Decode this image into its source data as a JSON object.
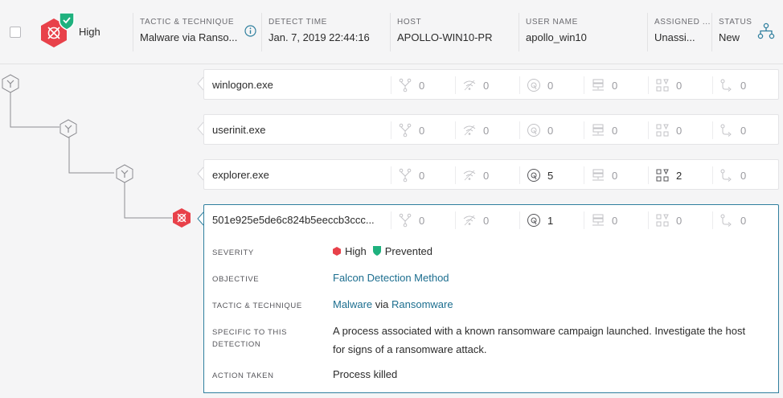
{
  "header": {
    "severity": "High",
    "tactic_label": "TACTIC & TECHNIQUE",
    "tactic_value": "Malware via Ranso...",
    "detect_label": "DETECT TIME",
    "detect_value": "Jan. 7, 2019 22:44:16",
    "host_label": "HOST",
    "host_value": "APOLLO-WIN10-PR",
    "user_label": "USER NAME",
    "user_value": "apollo_win10",
    "assigned_label": "ASSIGNED ...",
    "assigned_value": "Unassi...",
    "status_label": "STATUS",
    "status_value": "New"
  },
  "processes": [
    {
      "name": "winlogon.exe",
      "stats": [
        "0",
        "0",
        "0",
        "0",
        "0",
        "0"
      ],
      "active": [
        false,
        false,
        false,
        false,
        false,
        false
      ]
    },
    {
      "name": "userinit.exe",
      "stats": [
        "0",
        "0",
        "0",
        "0",
        "0",
        "0"
      ],
      "active": [
        false,
        false,
        false,
        false,
        false,
        false
      ]
    },
    {
      "name": "explorer.exe",
      "stats": [
        "0",
        "0",
        "5",
        "0",
        "2",
        "0"
      ],
      "active": [
        false,
        false,
        true,
        false,
        true,
        false
      ]
    },
    {
      "name": "501e925e5de6c824b5eeccb3ccc...",
      "stats": [
        "0",
        "0",
        "1",
        "0",
        "0",
        "0"
      ],
      "active": [
        false,
        false,
        true,
        false,
        false,
        false
      ]
    }
  ],
  "stat_icons": [
    "process-tree-icon",
    "network-icon",
    "disk-icon",
    "registry-icon",
    "modules-icon",
    "path-icon"
  ],
  "detail": {
    "severity_label": "SEVERITY",
    "severity_value": "High",
    "prevented_value": "Prevented",
    "objective_label": "OBJECTIVE",
    "objective_value": "Falcon Detection Method",
    "tactic_label": "TACTIC & TECHNIQUE",
    "tactic_malware": "Malware",
    "tactic_via": "via",
    "tactic_ransomware": "Ransomware",
    "specific_label": "SPECIFIC TO THIS DETECTION",
    "specific_value": "A process associated with a known ransomware campaign launched. Investigate the host for signs of a ransomware attack.",
    "action_label": "ACTION TAKEN",
    "action_value": "Process killed"
  },
  "colors": {
    "high": "#e8414a",
    "prevented": "#1fb17e",
    "link": "#1c6e8f",
    "selected_border": "#2f7f9e"
  }
}
